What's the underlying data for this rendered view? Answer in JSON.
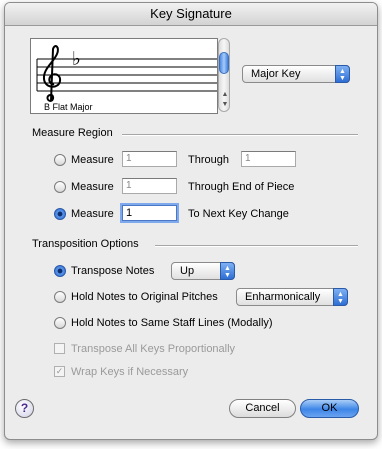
{
  "window": {
    "title": "Key Signature"
  },
  "preview": {
    "caption": "B Flat Major",
    "key_glyph": "♭"
  },
  "key_type": {
    "selected": "Major Key"
  },
  "measure_region": {
    "label": "Measure Region",
    "options": [
      {
        "label": "Measure",
        "from": "1",
        "to_label": "Through",
        "to": "1",
        "selected": false
      },
      {
        "label": "Measure",
        "from": "1",
        "to_label": "Through End of Piece",
        "selected": false
      },
      {
        "label": "Measure",
        "from": "1",
        "to_label": "To Next Key Change",
        "selected": true
      }
    ]
  },
  "transposition": {
    "label": "Transposition Options",
    "transpose_notes": {
      "label": "Transpose Notes",
      "direction": "Up",
      "selected": true
    },
    "hold_original": {
      "label": "Hold Notes to Original Pitches",
      "mode": "Enharmonically",
      "selected": false
    },
    "hold_staff": {
      "label": "Hold Notes to Same Staff Lines (Modally)",
      "selected": false
    },
    "transpose_all": {
      "label": "Transpose All Keys Proportionally",
      "checked": false
    },
    "wrap_keys": {
      "label": "Wrap Keys if Necessary",
      "checked": true,
      "mark": "✓"
    }
  },
  "buttons": {
    "cancel": "Cancel",
    "ok": "OK",
    "help": "?"
  }
}
